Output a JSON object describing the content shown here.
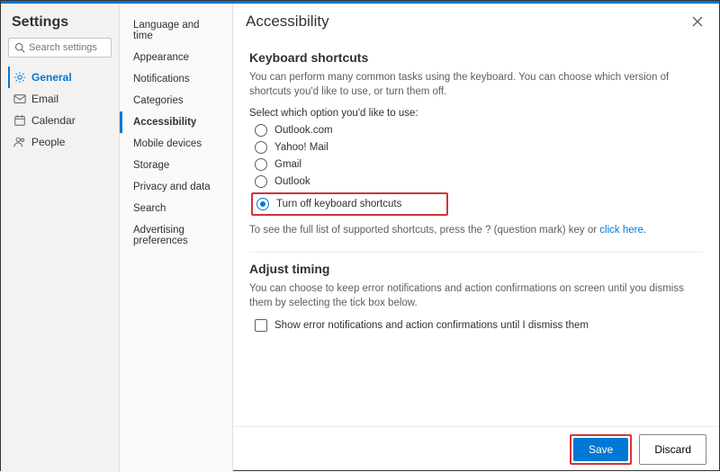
{
  "header": {
    "title": "Settings"
  },
  "search": {
    "placeholder": "Search settings"
  },
  "nav": {
    "items": [
      {
        "label": "General"
      },
      {
        "label": "Email"
      },
      {
        "label": "Calendar"
      },
      {
        "label": "People"
      }
    ]
  },
  "subnav": {
    "items": [
      {
        "label": "Language and time"
      },
      {
        "label": "Appearance"
      },
      {
        "label": "Notifications"
      },
      {
        "label": "Categories"
      },
      {
        "label": "Accessibility"
      },
      {
        "label": "Mobile devices"
      },
      {
        "label": "Storage"
      },
      {
        "label": "Privacy and data"
      },
      {
        "label": "Search"
      },
      {
        "label": "Advertising preferences"
      }
    ]
  },
  "panel": {
    "title": "Accessibility",
    "shortcuts": {
      "heading": "Keyboard shortcuts",
      "desc": "You can perform many common tasks using the keyboard. You can choose which version of shortcuts you'd like to use, or turn them off.",
      "select_label": "Select which option you'd like to use:",
      "options": [
        "Outlook.com",
        "Yahoo! Mail",
        "Gmail",
        "Outlook",
        "Turn off keyboard shortcuts"
      ],
      "help_pre": "To see the full list of supported shortcuts, press the ? (question mark) key or ",
      "help_link": "click here",
      "help_post": "."
    },
    "timing": {
      "heading": "Adjust timing",
      "desc": "You can choose to keep error notifications and action confirmations on screen until you dismiss them by selecting the tick box below.",
      "checkbox_label": "Show error notifications and action confirmations until I dismiss them"
    }
  },
  "footer": {
    "save": "Save",
    "discard": "Discard"
  }
}
